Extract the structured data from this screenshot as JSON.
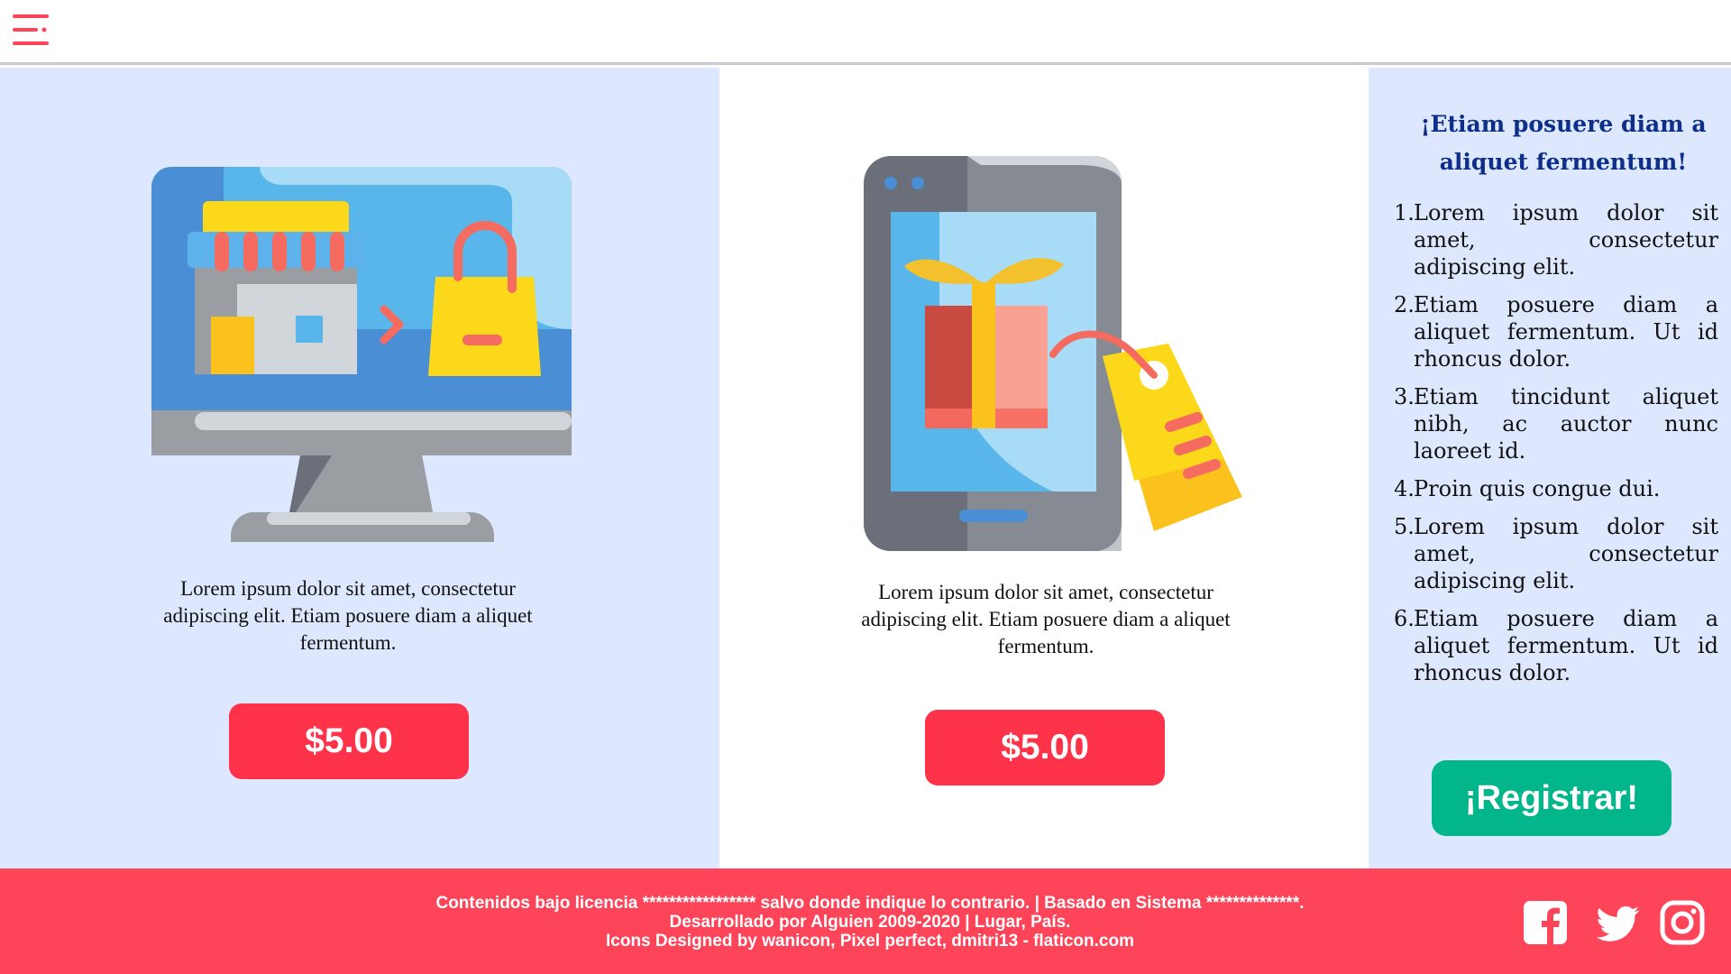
{
  "header": {
    "menu_icon": "hamburger-menu-icon"
  },
  "products": [
    {
      "illustration": "desktop-online-store-icon",
      "description": "Lorem ipsum dolor sit amet, consectetur adipiscing elit. Etiam posuere diam a aliquet fermentum.",
      "price": "$5.00"
    },
    {
      "illustration": "mobile-gift-discount-icon",
      "description": "Lorem ipsum dolor sit amet, consectetur adipiscing elit. Etiam posuere diam a aliquet fermentum.",
      "price": "$5.00"
    }
  ],
  "sidebar": {
    "title": "¡Etiam posuere diam a aliquet fermentum!",
    "items": [
      {
        "num": "1.",
        "text": "Lorem ipsum dolor sit amet, consectetur adipiscing elit."
      },
      {
        "num": "2.",
        "text": "Etiam posuere diam a aliquet fermentum. Ut id rhoncus dolor."
      },
      {
        "num": "3.",
        "text": "Etiam tincidunt aliquet nibh, ac auctor nunc laoreet id."
      },
      {
        "num": "4.",
        "text": "Proin quis congue dui."
      },
      {
        "num": "5.",
        "text": "Lorem ipsum dolor sit amet, consectetur adipiscing elit."
      },
      {
        "num": "6.",
        "text": "Etiam posuere diam a aliquet fermentum. Ut id rhoncus dolor."
      }
    ],
    "register_label": "¡Registrar!"
  },
  "footer": {
    "line1": "Contenidos bajo licencia ***************** salvo donde indique lo contrario. | Basado en Sistema **************.",
    "line2": "Desarrollado por Alguien 2009-2020 | Lugar, País.",
    "line3": "Icons Designed by wanicon, Pixel perfect, dmitri13 - flaticon.com",
    "social": [
      "facebook-icon",
      "twitter-icon",
      "instagram-icon"
    ]
  },
  "colors": {
    "accent_red": "#fe3249",
    "footer_red": "#fe4459",
    "register_green": "#00b68a",
    "panel_blue": "#dde7fd",
    "title_navy": "#0d2f8a"
  }
}
